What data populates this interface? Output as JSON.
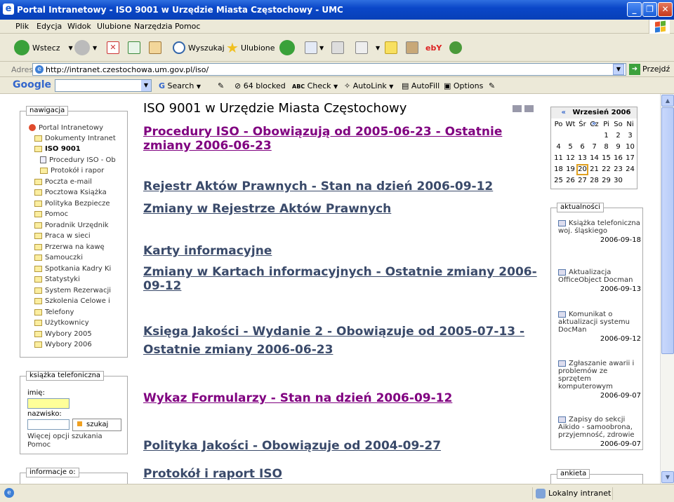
{
  "window": {
    "title": "Portal Intranetowy - ISO 9001 w Urzędzie Miasta Częstochowy - UMC"
  },
  "menu": [
    "Plik",
    "Edycja",
    "Widok",
    "Ulubione",
    "Narzędzia",
    "Pomoc"
  ],
  "toolbar": {
    "back": "Wstecz",
    "search": "Wyszukaj",
    "favorites": "Ulubione"
  },
  "address": {
    "label": "Adres",
    "url": "http://intranet.czestochowa.um.gov.pl/iso/",
    "go": "Przejdź"
  },
  "google": {
    "logo": "Google",
    "search": "Search",
    "blocked": "64 blocked",
    "check": "Check",
    "autolink": "AutoLink",
    "autofill": "AutoFill",
    "options": "Options"
  },
  "nav": {
    "header": "nawigacja",
    "items": [
      "Portal Intranetowy",
      "Dokumenty Intranet",
      "ISO 9001",
      "Procedury ISO - Ob",
      "Protokół i rapor",
      "Poczta e-mail",
      "Pocztowa Książka",
      "Polityka Bezpiecze",
      "Pomoc",
      "Poradnik Urzędnik",
      "Praca w sieci",
      "Przerwa na kawę",
      "Samouczki",
      "Spotkania Kadry Ki",
      "Statystyki",
      "System Rezerwacji",
      "Szkolenia Celowe i",
      "Telefony",
      "Użytkownicy",
      "Wybory 2005",
      "Wybory 2006"
    ]
  },
  "phonebook": {
    "header": "książka telefoniczna",
    "name_label": "imię:",
    "surname_label": "nazwisko:",
    "search_button": "szukaj",
    "more_link": "Więcej opcji szukania",
    "help_link": "Pomoc"
  },
  "info": {
    "header": "informacje o:"
  },
  "page": {
    "title": "ISO 9001 w Urzędzie Miasta Częstochowy"
  },
  "links": [
    "Procedury ISO - Obowiązują od 2005-06-23 - Ostatnie zmiany 2006-06-23",
    "Rejestr Aktów Prawnych - Stan na dzień 2006-09-12",
    "Zmiany w Rejestrze Aktów Prawnych",
    "Karty informacyjne",
    "Zmiany w Kartach informacyjnych - Ostatnie zmiany 2006-09-12",
    "Księga Jakości - Wydanie 2 - Obowiązuje od 2005-07-13 - Ostatnie zmiany 2006-06-23",
    "Wykaz Formularzy - Stan na dzień 2006-09-12",
    "Polityka Jakości - Obowiązuje od 2004-09-27",
    "Protokół i raport ISO"
  ],
  "calendar": {
    "prev": "«",
    "month": "Wrzesień 2006",
    "next": "»",
    "days": [
      "Po",
      "Wt",
      "Śr",
      "Cz",
      "Pi",
      "So",
      "Ni"
    ],
    "weeks": [
      [
        "",
        "",
        "",
        "",
        "1",
        "2",
        "3"
      ],
      [
        "4",
        "5",
        "6",
        "7",
        "8",
        "9",
        "10"
      ],
      [
        "11",
        "12",
        "13",
        "14",
        "15",
        "16",
        "17"
      ],
      [
        "18",
        "19",
        "20",
        "21",
        "22",
        "23",
        "24"
      ],
      [
        "25",
        "26",
        "27",
        "28",
        "29",
        "30",
        ""
      ]
    ]
  },
  "news": {
    "header": "aktualności",
    "items": [
      {
        "text": "Książka telefoniczna woj. śląskiego",
        "date": "2006-09-18"
      },
      {
        "text": "Aktualizacja OfficeObject Docman",
        "date": "2006-09-13"
      },
      {
        "text": "Komunikat o aktualizacji systemu DocMan",
        "date": "2006-09-12"
      },
      {
        "text": "Zgłaszanie awarii i problemów ze sprzętem komputerowym",
        "date": "2006-09-07"
      },
      {
        "text": "Zapisy do sekcji Aikido - samoobrona, przyjemność, zdrowie",
        "date": "2006-09-07"
      }
    ]
  },
  "poll": {
    "header": "ankieta"
  },
  "status": {
    "zone": "Lokalny intranet"
  }
}
